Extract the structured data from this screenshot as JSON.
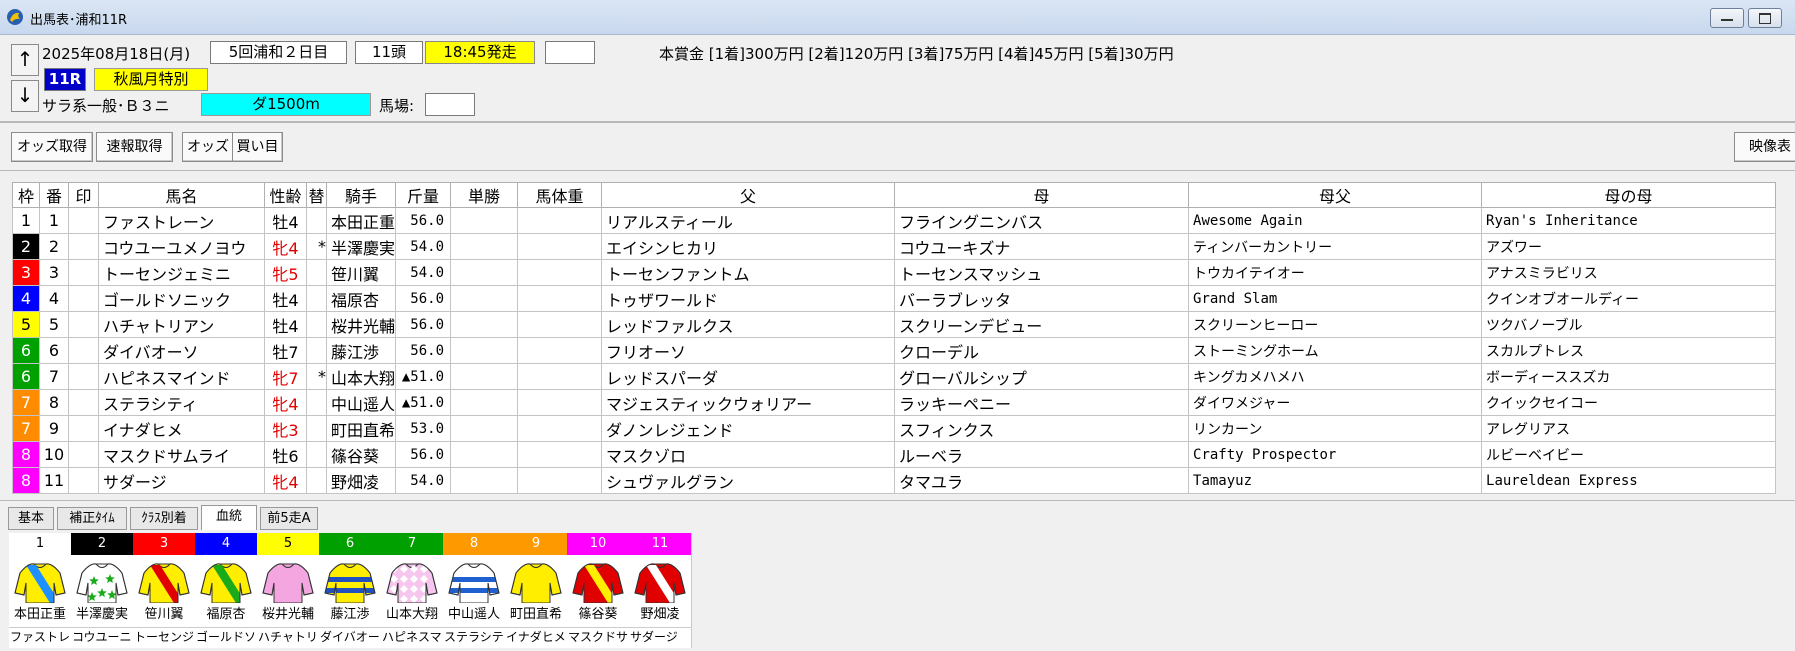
{
  "window": {
    "title": "出馬表･浦和11R"
  },
  "race": {
    "date": "2025年08月18日(月)",
    "meeting": "5回浦和２日目",
    "runners": "11頭",
    "post_time": "18:45発走",
    "post_time_bg": "#ffff00",
    "extra_box": "",
    "race_no": "11R",
    "race_no_bg": "#0000c8",
    "race_name": "秋風月特別",
    "race_name_bg": "#ffff00",
    "class": "サラ系一般･Ｂ３ニ",
    "distance": "ダ1500m",
    "distance_bg": "#00ffff",
    "track_label": "馬場:",
    "track_value": "",
    "prize": "本賞金 [1着]300万円 [2着]120万円 [3着]75万円 [4着]45万円 [5着]30万円"
  },
  "nav": {
    "up": "↑",
    "down": "↓"
  },
  "toolbar": {
    "odds_fetch": "オッズ取得",
    "quick_fetch": "速報取得",
    "odds": "オッズ",
    "buy": "買い目",
    "video": "映像表"
  },
  "table": {
    "headers": [
      "枠",
      "番",
      "印",
      "馬名",
      "性齢",
      "替",
      "騎手",
      "斤量",
      "単勝",
      "馬体重",
      "父",
      "母",
      "母父",
      "母の母"
    ],
    "rows": [
      {
        "waku": "1",
        "num": "1",
        "mark": "",
        "name": "ファストレーン",
        "sexage": "牡4",
        "mare": false,
        "change": "",
        "jockey": "本田正重",
        "weight": "56.0",
        "win": "",
        "bw": "",
        "sire": "リアルスティール",
        "dam": "フライングニンバス",
        "damsire": "Awesome Again",
        "damdam": "Ryan's Inheritance"
      },
      {
        "waku": "2",
        "num": "2",
        "mark": "",
        "name": "コウユーユメノヨウ",
        "sexage": "牝4",
        "mare": true,
        "change": "*",
        "jockey": "半澤慶実",
        "weight": "54.0",
        "win": "",
        "bw": "",
        "sire": "エイシンヒカリ",
        "dam": "コウユーキズナ",
        "damsire": "ティンバーカントリー",
        "damdam": "アズワー"
      },
      {
        "waku": "3",
        "num": "3",
        "mark": "",
        "name": "トーセンジェミニ",
        "sexage": "牝5",
        "mare": true,
        "change": "",
        "jockey": "笹川翼",
        "weight": "54.0",
        "win": "",
        "bw": "",
        "sire": "トーセンファントム",
        "dam": "トーセンスマッシュ",
        "damsire": "トウカイテイオー",
        "damdam": "アナスミラビリス"
      },
      {
        "waku": "4",
        "num": "4",
        "mark": "",
        "name": "ゴールドソニック",
        "sexage": "牡4",
        "mare": false,
        "change": "",
        "jockey": "福原杏",
        "weight": "56.0",
        "win": "",
        "bw": "",
        "sire": "トゥザワールド",
        "dam": "バーラブレッタ",
        "damsire": "Grand Slam",
        "damdam": "クインオブオールディー"
      },
      {
        "waku": "5",
        "num": "5",
        "mark": "",
        "name": "ハチャトリアン",
        "sexage": "牡4",
        "mare": false,
        "change": "",
        "jockey": "桜井光輔",
        "weight": "56.0",
        "win": "",
        "bw": "",
        "sire": "レッドファルクス",
        "dam": "スクリーンデビュー",
        "damsire": "スクリーンヒーロー",
        "damdam": "ツクバノーブル"
      },
      {
        "waku": "6",
        "num": "6",
        "mark": "",
        "name": "ダイバオーソ",
        "sexage": "牡7",
        "mare": false,
        "change": "",
        "jockey": "藤江渉",
        "weight": "56.0",
        "win": "",
        "bw": "",
        "sire": "フリオーソ",
        "dam": "クローデル",
        "damsire": "ストーミングホーム",
        "damdam": "スカルプトレス"
      },
      {
        "waku": "6",
        "num": "7",
        "mark": "",
        "name": "ハピネスマインド",
        "sexage": "牝7",
        "mare": true,
        "change": "*",
        "jockey": "山本大翔",
        "weight": "▲51.0",
        "win": "",
        "bw": "",
        "sire": "レッドスパーダ",
        "dam": "グローバルシップ",
        "damsire": "キングカメハメハ",
        "damdam": "ボーディーススズカ"
      },
      {
        "waku": "7",
        "num": "8",
        "mark": "",
        "name": "ステラシティ",
        "sexage": "牝4",
        "mare": true,
        "change": "",
        "jockey": "中山遥人",
        "weight": "▲51.0",
        "win": "",
        "bw": "",
        "sire": "マジェスティックウォリアー",
        "dam": "ラッキーペニー",
        "damsire": "ダイワメジャー",
        "damdam": "クイックセイコー"
      },
      {
        "waku": "7",
        "num": "9",
        "mark": "",
        "name": "イナダヒメ",
        "sexage": "牝3",
        "mare": true,
        "change": "",
        "jockey": "町田直希",
        "weight": "53.0",
        "win": "",
        "bw": "",
        "sire": "ダノンレジェンド",
        "dam": "スフィンクス",
        "damsire": "リンカーン",
        "damdam": "アレグリアス"
      },
      {
        "waku": "8",
        "num": "10",
        "mark": "",
        "name": "マスクドサムライ",
        "sexage": "牡6",
        "mare": false,
        "change": "",
        "jockey": "篠谷葵",
        "weight": "56.0",
        "win": "",
        "bw": "",
        "sire": "マスクゾロ",
        "dam": "ルーベラ",
        "damsire": "Crafty Prospector",
        "damdam": "ルビーベイビー"
      },
      {
        "waku": "8",
        "num": "11",
        "mark": "",
        "name": "サダージ",
        "sexage": "牝4",
        "mare": true,
        "change": "",
        "jockey": "野畑凌",
        "weight": "54.0",
        "win": "",
        "bw": "",
        "sire": "シュヴァルグラン",
        "dam": "タマユラ",
        "damsire": "Tamayuz",
        "damdam": "Laureldean Express"
      }
    ]
  },
  "waku_colors": {
    "1": {
      "bg": "#ffffff",
      "fg": "#000000"
    },
    "2": {
      "bg": "#000000",
      "fg": "#ffffff"
    },
    "3": {
      "bg": "#ff0000",
      "fg": "#ffffff"
    },
    "4": {
      "bg": "#0000ff",
      "fg": "#ffffff"
    },
    "5": {
      "bg": "#ffff00",
      "fg": "#000000"
    },
    "6": {
      "bg": "#00a000",
      "fg": "#ffffff"
    },
    "7": {
      "bg": "#ff8c00",
      "fg": "#ffffff"
    },
    "8": {
      "bg": "#ff00ff",
      "fg": "#ffffff"
    }
  },
  "tabs": [
    "基本",
    "補正ﾀｲﾑ",
    "ｸﾗｽ別着",
    "血統",
    "前5走A"
  ],
  "active_tab": 3,
  "silks": [
    {
      "num": "1",
      "waku": "1",
      "jockey": "本田正重",
      "horse": "ファストレ",
      "body": "#ffee00",
      "pattern": "sash",
      "accent": "#1e90ff",
      "sleeve": "#ffee00"
    },
    {
      "num": "2",
      "waku": "2",
      "jockey": "半澤慶実",
      "horse": "コウユーニ",
      "body": "#ffffff",
      "pattern": "stars",
      "accent": "#1aaa1a",
      "sleeve": "#e00000"
    },
    {
      "num": "3",
      "waku": "3",
      "jockey": "笹川翼",
      "horse": "トーセンジ",
      "body": "#ffee00",
      "pattern": "sash",
      "accent": "#e00000",
      "sleeve": "#ffee00"
    },
    {
      "num": "4",
      "waku": "4",
      "jockey": "福原杏",
      "horse": "ゴールドソ",
      "body": "#ffee00",
      "pattern": "sash",
      "accent": "#1aaa1a",
      "sleeve": "#ffee00"
    },
    {
      "num": "5",
      "waku": "5",
      "jockey": "桜井光輔",
      "horse": "ハチャトリ",
      "body": "#f4a6e0",
      "pattern": "plain",
      "accent": "#f4a6e0",
      "sleeve": "#f4a6e0"
    },
    {
      "num": "6",
      "waku": "6",
      "jockey": "藤江渉",
      "horse": "ダイバオー",
      "body": "#ffee00",
      "pattern": "hoops",
      "accent": "#2050c0",
      "sleeve": "#ffee00"
    },
    {
      "num": "7",
      "waku": "6",
      "jockey": "山本大翔",
      "horse": "ハピネスマ",
      "body": "#f7c6ee",
      "pattern": "diamonds",
      "accent": "#ffffff",
      "sleeve": "#f7c6ee"
    },
    {
      "num": "8",
      "waku": "7",
      "jockey": "中山遥人",
      "horse": "ステラシテ",
      "body": "#ffffff",
      "pattern": "hoops",
      "accent": "#1e60d0",
      "sleeve": "#ffffff"
    },
    {
      "num": "9",
      "waku": "7",
      "jockey": "町田直希",
      "horse": "イナダヒメ",
      "body": "#ffee00",
      "pattern": "plain",
      "accent": "#ffee00",
      "sleeve": "#ffee00"
    },
    {
      "num": "10",
      "waku": "8",
      "jockey": "篠谷葵",
      "horse": "マスクドサ",
      "body": "#e00000",
      "pattern": "sash",
      "accent": "#ffee00",
      "sleeve": "#e00000"
    },
    {
      "num": "11",
      "waku": "8",
      "jockey": "野畑凌",
      "horse": "サダージ",
      "body": "#e00000",
      "pattern": "sash",
      "accent": "#ffffff",
      "sleeve": "#e00000"
    }
  ],
  "silk_header_colors": {
    "1": {
      "bg": "#ffffff",
      "fg": "#000000"
    },
    "2": {
      "bg": "#000000",
      "fg": "#ffffff"
    },
    "3": {
      "bg": "#ff0000",
      "fg": "#ffffff"
    },
    "4": {
      "bg": "#0000ff",
      "fg": "#ffffff"
    },
    "5": {
      "bg": "#ffff00",
      "fg": "#000000"
    },
    "6": {
      "bg": "#00a000",
      "fg": "#ffffff"
    },
    "7": {
      "bg": "#ff9900",
      "fg": "#ffffff"
    },
    "8": {
      "bg": "#ff00ff",
      "fg": "#ffffff"
    }
  }
}
